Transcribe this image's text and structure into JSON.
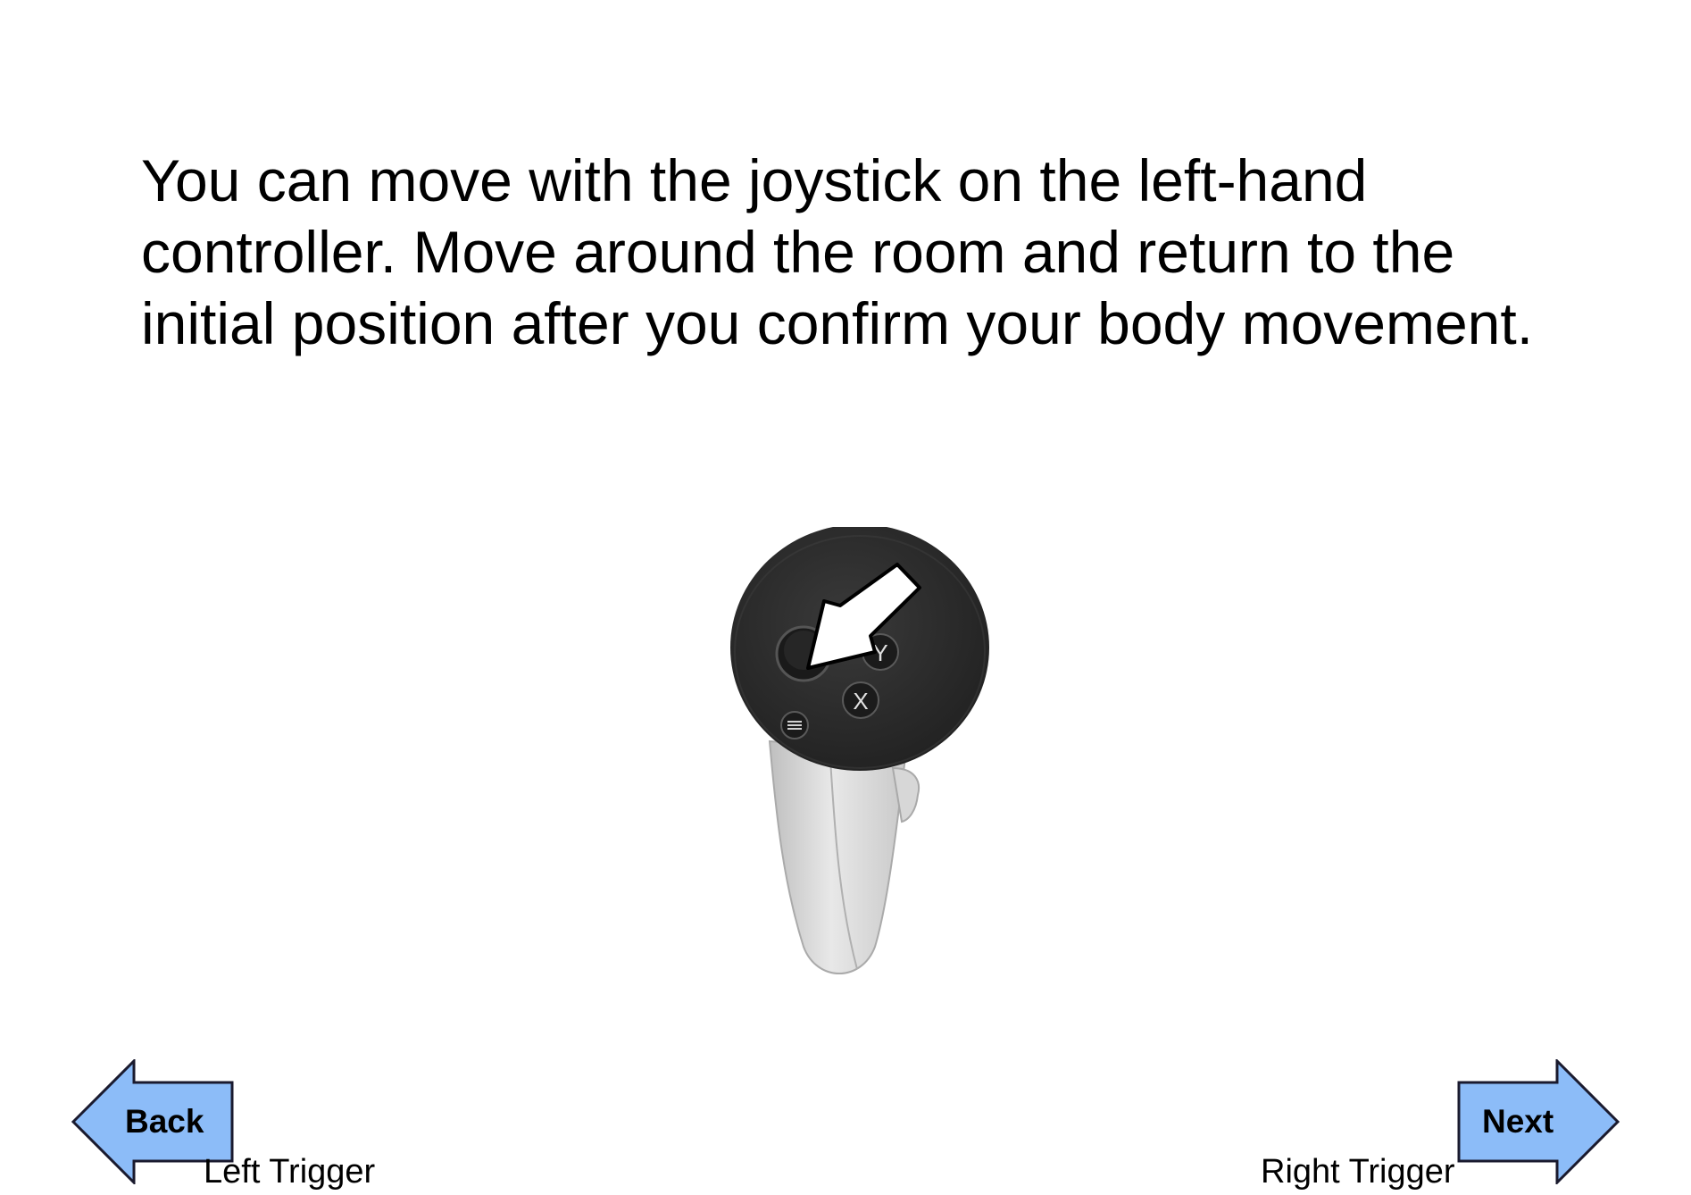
{
  "instruction": "You can move with the joystick on the left-hand\ncontroller. Move around the room and return to the\ninitial position after you confirm your body movement.",
  "controller": {
    "button_y": "Y",
    "button_x": "X"
  },
  "navigation": {
    "back_label": "Back",
    "next_label": "Next",
    "left_trigger_label": "Left Trigger",
    "right_trigger_label": "Right Trigger"
  },
  "colors": {
    "arrow_fill": "#8cbcf8",
    "arrow_stroke": "#1a1a2e",
    "controller_head": "#2b2b2b",
    "controller_body": "#dcdcdc"
  }
}
